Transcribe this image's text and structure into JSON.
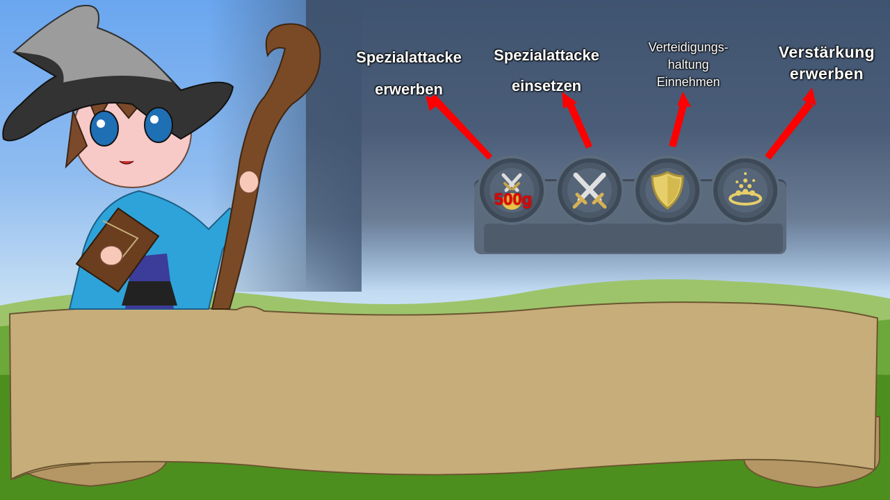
{
  "labels": {
    "buy_special": [
      "Spezialattacke",
      "erwerben"
    ],
    "use_special": [
      "Spezialattacke",
      "einsetzen"
    ],
    "defense": [
      "Verteidigungs-",
      "haltung",
      "Einnehmen"
    ],
    "reinforcement": [
      "Verstärkung",
      "erwerben"
    ]
  },
  "actions": {
    "buy_special_cost": "500g"
  },
  "icons": {
    "slot1": "swords-with-gold-icon",
    "slot2": "crossed-swords-icon",
    "slot3": "shield-icon",
    "slot4": "gold-pile-icon"
  },
  "colors": {
    "arrow": "#ff0000",
    "cost": "#e30000",
    "toolbar": "#5b6a7c",
    "parchment": "#c6ad7a"
  }
}
